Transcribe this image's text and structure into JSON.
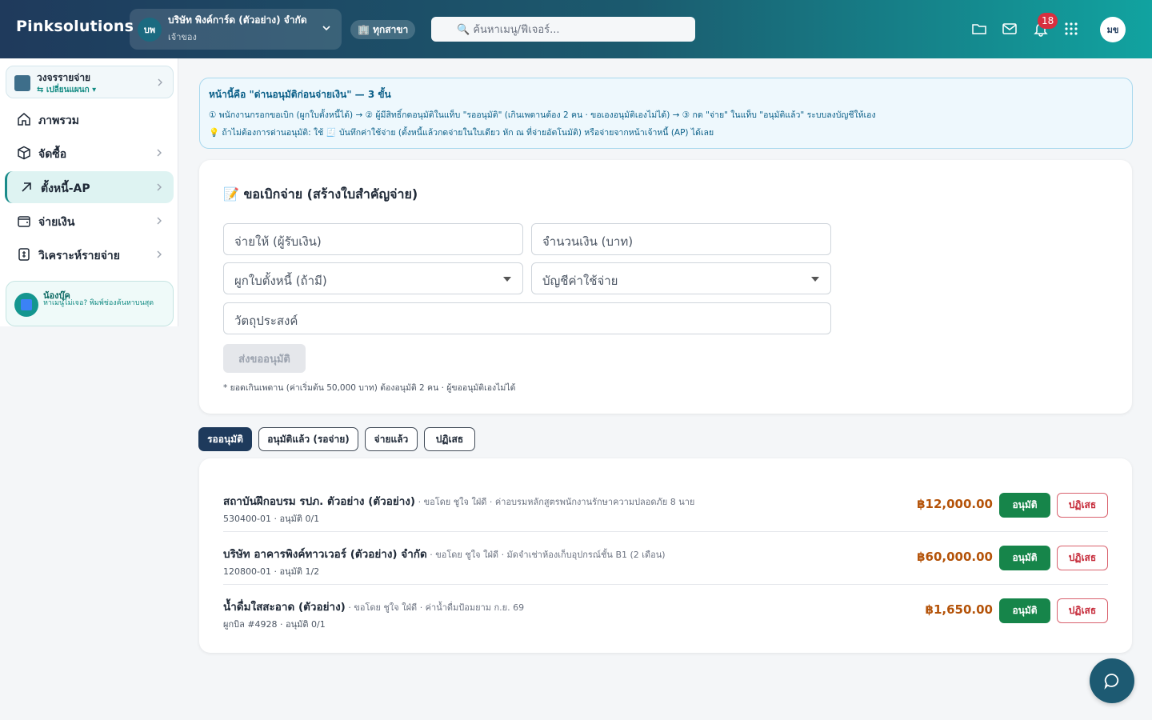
{
  "header": {
    "brand": "Pinksolutions",
    "company_logo": "บพ",
    "company_name": "บริษัท พิงค์การ์ด (ตัวอย่าง) จำกัด",
    "company_role": "เจ้าของ",
    "branch_label": "🏢 ทุกสาขา",
    "search_placeholder": "🔍 ค้นหาเมนู/ฟีเจอร์...",
    "notification_count": "18",
    "avatar_initials": "มข",
    "icons": [
      "folder-icon",
      "mail-icon",
      "bell-icon",
      "apps-grid-icon"
    ]
  },
  "sidebar": {
    "plan_title": "วงจรรายจ่าย",
    "plan_switch": "⇆ เปลี่ยนแผนก ▾",
    "items": [
      {
        "label": "ภาพรวม",
        "icon": "home-icon",
        "active": false,
        "has_chevron": false
      },
      {
        "label": "จัดซื้อ",
        "icon": "box-icon",
        "active": false,
        "has_chevron": true
      },
      {
        "label": "ตั้งหนี้-AP",
        "icon": "arrow-up-right-icon",
        "active": true,
        "has_chevron": true
      },
      {
        "label": "จ่ายเงิน",
        "icon": "wallet-icon",
        "active": false,
        "has_chevron": true
      },
      {
        "label": "วิเคราะห์รายจ่าย",
        "icon": "receipt-icon",
        "active": false,
        "has_chevron": true
      }
    ],
    "helper_title": "น้องบุ๊ค",
    "helper_text": "หาเมนูไม่เจอ? พิมพ์ช่องค้นหาบนสุด"
  },
  "callout": {
    "title": "หน้านี้คือ \"ด่านอนุมัติก่อนจ่ายเงิน\" — 3 ขั้น",
    "steps": "① พนักงานกรอกขอเบิก (ผูกใบตั้งหนี้ได้) → ② ผู้มีสิทธิ์กดอนุมัติในแท็บ \"รออนุมัติ\" (เกินเพดานต้อง 2 คน · ขอเองอนุมัติเองไม่ได้) → ③ กด \"จ่าย\" ในแท็บ \"อนุมัติแล้ว\" ระบบลงบัญชีให้เอง",
    "tip": "💡 ถ้าไม่ต้องการด่านอนุมัติ: ใช้ 🧾 บันทึกค่าใช้จ่าย (ตั้งหนี้แล้วกดจ่ายในใบเดียว หัก ณ ที่จ่ายอัตโนมัติ) หรือจ่ายจากหน้าเจ้าหนี้ (AP) ได้เลย"
  },
  "form": {
    "title": "📝 ขอเบิกจ่าย (สร้างใบสำคัญจ่าย)",
    "payee_placeholder": "จ่ายให้ (ผู้รับเงิน)",
    "amount_placeholder": "จำนวนเงิน (บาท)",
    "bill_select": "ผูกใบตั้งหนี้ (ถ้ามี)",
    "account_select": "บัญชีค่าใช้จ่าย",
    "purpose_placeholder": "วัตถุประสงค์",
    "submit_label": "ส่งขออนุมัติ",
    "note": "* ยอดเกินเพดาน (ค่าเริ่มต้น 50,000 บาท) ต้องอนุมัติ 2 คน · ผู้ขออนุมัติเองไม่ได้"
  },
  "tabs": [
    {
      "label": "รออนุมัติ",
      "active": true
    },
    {
      "label": "อนุมัติแล้ว (รอจ่าย)",
      "active": false
    },
    {
      "label": "จ่ายแล้ว",
      "active": false
    },
    {
      "label": "ปฏิเสธ",
      "active": false
    }
  ],
  "requests": [
    {
      "vendor": "สถาบันฝึกอบรม รปภ. ตัวอย่าง (ตัวอย่าง)",
      "meta": " · ขอโดย ชูใจ ใฝ่ดี · ค่าอบรมหลักสูตรพนักงานรักษาความปลอดภัย 8 นาย",
      "ref": "530400-01 · อนุมัติ 0/1",
      "amount": "฿12,000.00",
      "approve_label": "อนุมัติ",
      "reject_label": "ปฏิเสธ"
    },
    {
      "vendor": "บริษัท อาคารพิงค์ทาวเวอร์ (ตัวอย่าง) จำกัด",
      "meta": " · ขอโดย ชูใจ ใฝ่ดี · มัดจำเช่าห้องเก็บอุปกรณ์ชั้น B1 (2 เดือน)",
      "ref": "120800-01 · อนุมัติ 1/2",
      "amount": "฿60,000.00",
      "approve_label": "อนุมัติ",
      "reject_label": "ปฏิเสธ"
    },
    {
      "vendor": "น้ำดื่มใสสะอาด (ตัวอย่าง)",
      "meta": " · ขอโดย ชูใจ ใฝ่ดี · ค่าน้ำดื่มป้อมยาม ก.ย. 69",
      "ref": "ผูกบิล #4928 · อนุมัติ 0/1",
      "amount": "฿1,650.00",
      "approve_label": "อนุมัติ",
      "reject_label": "ปฏิเสธ"
    }
  ],
  "colors": {
    "header_start": "#1f3a5c",
    "header_end": "#11a3a0",
    "approve": "#16854a",
    "reject": "#c62c3b",
    "amount": "#b45309",
    "active_tab": "#1e3a5c"
  }
}
